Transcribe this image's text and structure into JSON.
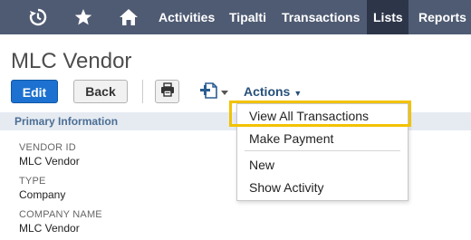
{
  "nav": {
    "icons": [
      "recent-history-icon",
      "star-icon",
      "home-icon"
    ],
    "items": [
      "Activities",
      "Tipalti",
      "Transactions",
      "Lists",
      "Reports"
    ],
    "active": "Lists",
    "colors": {
      "bar": "#4f5b73",
      "active": "#2d3549"
    }
  },
  "record": {
    "title": "MLC Vendor"
  },
  "toolbar": {
    "edit_label": "Edit",
    "back_label": "Back",
    "actions_label": "Actions"
  },
  "section": {
    "title": "Primary Information"
  },
  "fields": [
    {
      "label": "VENDOR ID",
      "value": "MLC Vendor"
    },
    {
      "label": "TYPE",
      "value": "Company"
    },
    {
      "label": "COMPANY NAME",
      "value": "MLC Vendor"
    }
  ],
  "actions_menu": {
    "items": [
      "View All Transactions",
      "Make Payment",
      "New",
      "Show Activity"
    ],
    "highlighted": "View All Transactions",
    "highlight_color": "#f2c200"
  }
}
